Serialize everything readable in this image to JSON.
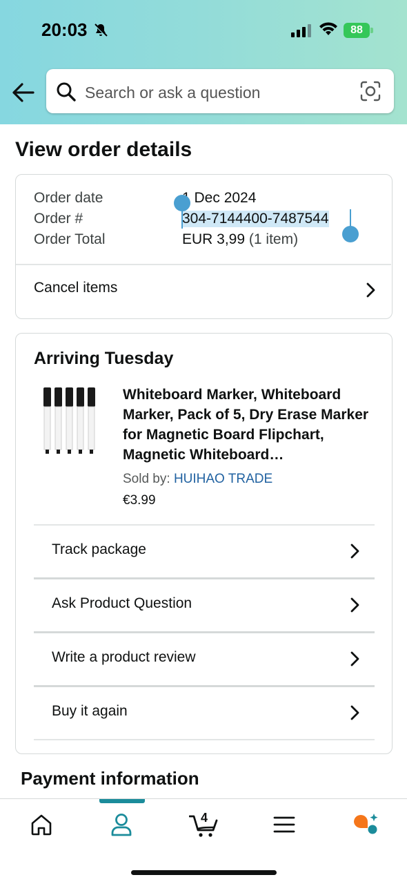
{
  "status_bar": {
    "time": "20:03",
    "battery": "88"
  },
  "search": {
    "placeholder": "Search or ask a question"
  },
  "page_title": "View order details",
  "order_summary": {
    "rows": [
      {
        "label": "Order date",
        "value": "1 Dec 2024"
      },
      {
        "label": "Order #",
        "value": "304-7144400-7487544"
      },
      {
        "label": "Order Total",
        "value": "EUR 3,99",
        "suffix": "(1 item)"
      }
    ],
    "cancel_label": "Cancel items"
  },
  "shipment": {
    "heading": "Arriving Tuesday",
    "product_title": "Whiteboard Marker, Whiteboard Marker, Pack of 5, Dry Erase Marker for Magnetic Board Flipchart, Magnetic Whiteboard…",
    "sold_by_label": "Sold by:",
    "seller": "HUIHAO TRADE",
    "price": "€3.99",
    "actions": [
      {
        "label": "Track package"
      },
      {
        "label": "Ask Product Question"
      },
      {
        "label": "Write a product review"
      },
      {
        "label": "Buy it again"
      }
    ]
  },
  "payment_heading": "Payment information",
  "tabbar": {
    "active": "account",
    "cart_count": "4",
    "tabs": [
      "home-icon",
      "account-icon",
      "cart-icon",
      "menu-icon",
      "rufus-icon"
    ]
  },
  "colors": {
    "accent": "#1b8c9b",
    "selection_handle": "#4a9fd1",
    "link": "#2162a1",
    "battery": "#34c759"
  }
}
